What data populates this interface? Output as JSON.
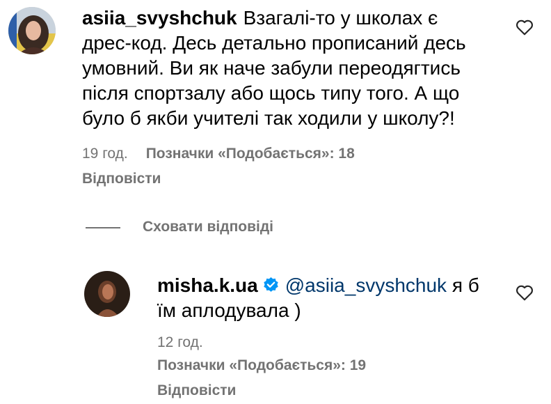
{
  "comment": {
    "username": "asiia_svyshchuk",
    "text_lines": [
      "Взагалі-то у школах є",
      "дрес-код. Десь детально прописаний десь",
      "умовний. Ви як наче забули переодягтись",
      "після спортзалу або щось типу того. А що",
      "було б якби учителі так ходили у школу?!"
    ],
    "time": "19 год.",
    "likes": "Позначки «Подобається»: 18",
    "reply_label": "Відповісти"
  },
  "hide_replies_label": "Сховати відповіді",
  "reply": {
    "username": "misha.k.ua",
    "mention": "@asiia_svyshchuk",
    "text_line1_tail": "я б",
    "text_line2": "їм аплодувала )",
    "time": "12 год.",
    "likes": "Позначки «Подобається»: 19",
    "reply_label": "Відповісти"
  },
  "colors": {
    "meta_gray": "#737373",
    "mention_blue": "#00376b",
    "verified_blue": "#0095f6"
  },
  "icons": [
    "heart-icon",
    "verified-badge-icon"
  ]
}
